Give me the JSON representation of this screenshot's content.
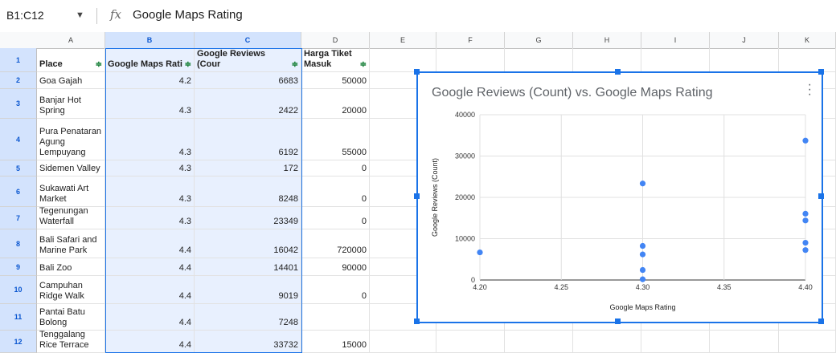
{
  "formula_bar": {
    "range": "B1:C12",
    "fx": "fx",
    "value": "Google Maps Rating"
  },
  "columns": [
    "A",
    "B",
    "C",
    "D",
    "E",
    "F",
    "G",
    "H",
    "I",
    "J",
    "K"
  ],
  "selected_columns": [
    "B",
    "C"
  ],
  "headers": {
    "place": "Place",
    "rating": "Google Maps Rati",
    "reviews": "Google Reviews (Cour",
    "price": "Harga Tiket Masuk"
  },
  "rows": [
    {
      "num": "2",
      "place": "Goa Gajah",
      "rating": "4.2",
      "reviews": "6683",
      "price": "50000"
    },
    {
      "num": "3",
      "place": "Banjar Hot Spring",
      "rating": "4.3",
      "reviews": "2422",
      "price": "20000"
    },
    {
      "num": "4",
      "place": "Pura Penataran Agung Lempuyang",
      "rating": "4.3",
      "reviews": "6192",
      "price": "55000"
    },
    {
      "num": "5",
      "place": "Sidemen Valley",
      "rating": "4.3",
      "reviews": "172",
      "price": "0"
    },
    {
      "num": "6",
      "place": "Sukawati Art Market",
      "rating": "4.3",
      "reviews": "8248",
      "price": "0"
    },
    {
      "num": "7",
      "place": "Tegenungan Waterfall",
      "rating": "4.3",
      "reviews": "23349",
      "price": "0"
    },
    {
      "num": "8",
      "place": "Bali Safari and Marine Park",
      "rating": "4.4",
      "reviews": "16042",
      "price": "720000"
    },
    {
      "num": "9",
      "place": "Bali Zoo",
      "rating": "4.4",
      "reviews": "14401",
      "price": "90000"
    },
    {
      "num": "10",
      "place": "Campuhan Ridge Walk",
      "rating": "4.4",
      "reviews": "9019",
      "price": "0"
    },
    {
      "num": "11",
      "place": "Pantai Batu Bolong",
      "rating": "4.4",
      "reviews": "7248",
      "price": ""
    },
    {
      "num": "12",
      "place": "Tenggalang Rice Terrace",
      "rating": "4.4",
      "reviews": "33732",
      "price": "15000"
    }
  ],
  "row1_num": "1",
  "chart_data": {
    "type": "scatter",
    "title": "Google Reviews (Count) vs. Google Maps Rating",
    "xlabel": "Google Maps Rating",
    "ylabel": "Google Reviews (Count)",
    "xlim": [
      4.2,
      4.4
    ],
    "ylim": [
      0,
      40000
    ],
    "xticks": [
      "4.20",
      "4.25",
      "4.30",
      "4.35",
      "4.40"
    ],
    "yticks": [
      "0",
      "10000",
      "20000",
      "30000",
      "40000"
    ],
    "grid": true,
    "series": [
      {
        "color": "#4285f4",
        "points": [
          [
            4.2,
            6683
          ],
          [
            4.3,
            2422
          ],
          [
            4.3,
            6192
          ],
          [
            4.3,
            172
          ],
          [
            4.3,
            8248
          ],
          [
            4.3,
            23349
          ],
          [
            4.4,
            16042
          ],
          [
            4.4,
            14401
          ],
          [
            4.4,
            9019
          ],
          [
            4.4,
            7248
          ],
          [
            4.4,
            33732
          ]
        ]
      }
    ]
  },
  "colors": {
    "accent": "#1a73e8",
    "selection": "#e8f0fe",
    "filter": "#188038"
  }
}
